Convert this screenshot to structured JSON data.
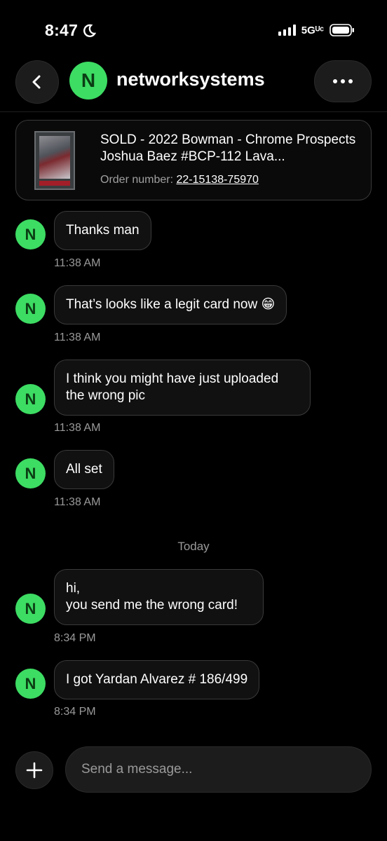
{
  "status_bar": {
    "time": "8:47",
    "network": "5Gᵁᶜ"
  },
  "header": {
    "avatar_letter": "N",
    "title": "networksystems"
  },
  "order_card": {
    "title": "SOLD - 2022 Bowman - Chrome Prospects Joshua Baez #BCP-112 Lava...",
    "order_label": "Order number: ",
    "order_number": "22-15138-75970"
  },
  "messages": [
    {
      "avatar": "N",
      "text": "Thanks man",
      "time": "11:38 AM"
    },
    {
      "avatar": "N",
      "text": "That’s looks like a legit card now 😁",
      "time": "11:38 AM"
    },
    {
      "avatar": "N",
      "text": "I think you might have just uploaded the wrong pic",
      "time": "11:38 AM"
    },
    {
      "avatar": "N",
      "text": "All set",
      "time": "11:38 AM"
    },
    {
      "avatar": "N",
      "text": "hi,\nyou send me the wrong card!",
      "time": "8:34 PM"
    },
    {
      "avatar": "N",
      "text": "I got Yardan Alvarez # 186/499",
      "time": "8:34 PM"
    }
  ],
  "day_divider": "Today",
  "composer": {
    "placeholder": "Send a message..."
  },
  "colors": {
    "avatar": "#3ddc63",
    "background": "#000000"
  }
}
